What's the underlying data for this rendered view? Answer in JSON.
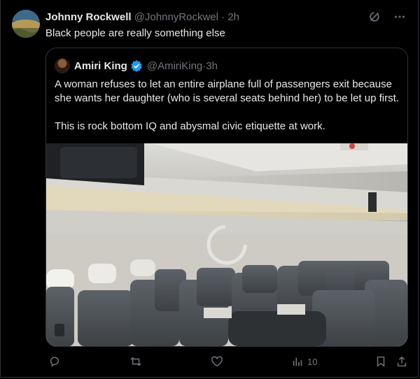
{
  "tweet": {
    "author_name": "Johnny Rockwell",
    "author_handle": "@JohnnyRockwel",
    "separator": " · ",
    "time": "2h",
    "text": "Black people are really something else"
  },
  "quote": {
    "author_name": "Amiri King",
    "author_handle": "@AmiriKing",
    "separator": " · ",
    "time": "3h",
    "paragraph1": "A woman refuses to let an entire airplane full of passengers exit because she wants her daughter (who is several seats behind her) to be let up first.",
    "paragraph2": "This is rock bottom IQ and abysmal civic etiquette at work."
  },
  "actions": {
    "views_count": "10"
  },
  "icons": {
    "grok": "grok-icon",
    "more": "more-icon",
    "verified": "verified-badge-icon",
    "reply": "reply-icon",
    "retweet": "retweet-icon",
    "like": "like-icon",
    "views": "views-icon",
    "bookmark": "bookmark-icon",
    "share": "share-icon"
  },
  "colors": {
    "background": "#000000",
    "text": "#e7e9ea",
    "muted": "#71767b",
    "verified": "#1d9bf0",
    "border": "#2f3336"
  }
}
